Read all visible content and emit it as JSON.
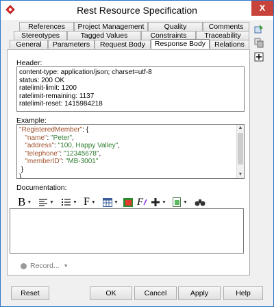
{
  "window": {
    "title": "Rest Resource Specification",
    "close_label": "X"
  },
  "tabs": {
    "row1": [
      "References",
      "Project Management",
      "Quality",
      "Comments"
    ],
    "row2": [
      "Stereotypes",
      "Tagged Values",
      "Constraints",
      "Traceability"
    ],
    "row3": [
      "General",
      "Parameters",
      "Request Body",
      "Response Body",
      "Relations"
    ],
    "active": "Response Body"
  },
  "header": {
    "label": "Header:",
    "lines": [
      "content-type: application/json; charset=utf-8",
      "status: 200 OK",
      "ratelimit-limit: 1200",
      "ratelimit-remaining: 1137",
      "ratelimit-reset: 1415984218"
    ]
  },
  "example": {
    "label": "Example:",
    "lines": [
      {
        "indent": "",
        "key": "\"RegisteredMember\"",
        "rest": ": {"
      },
      {
        "indent": "   ",
        "key": "\"name\"",
        "sep": ": ",
        "val": "\"Peter\"",
        "end": ","
      },
      {
        "indent": "   ",
        "key": "\"address\"",
        "sep": ": ",
        "val": "\"100, Happy Valley\"",
        "end": ","
      },
      {
        "indent": "   ",
        "key": "\"telephone\"",
        "sep": ": ",
        "val": "\"12345678\"",
        "end": ","
      },
      {
        "indent": "   ",
        "key": "\"memberID\"",
        "sep": ": ",
        "val": "\"MB-3001\"",
        "end": ""
      },
      {
        "indent": " ",
        "key": "",
        "rest": "}"
      },
      {
        "indent": "",
        "key": "",
        "rest": "}"
      }
    ],
    "colors": {
      "key": "#a0522d",
      "value": "#2e7d32"
    }
  },
  "documentation": {
    "label": "Documentation:",
    "toolbar": [
      "bold-font-icon",
      "align-icon",
      "list-icon",
      "font-icon",
      "table-icon",
      "color-icon",
      "format-icon",
      "insert-icon",
      "image-icon",
      "find-icon"
    ],
    "value": ""
  },
  "record": {
    "label": "Record..."
  },
  "buttons": {
    "reset": "Reset",
    "ok": "OK",
    "cancel": "Cancel",
    "apply": "Apply",
    "help": "Help"
  }
}
